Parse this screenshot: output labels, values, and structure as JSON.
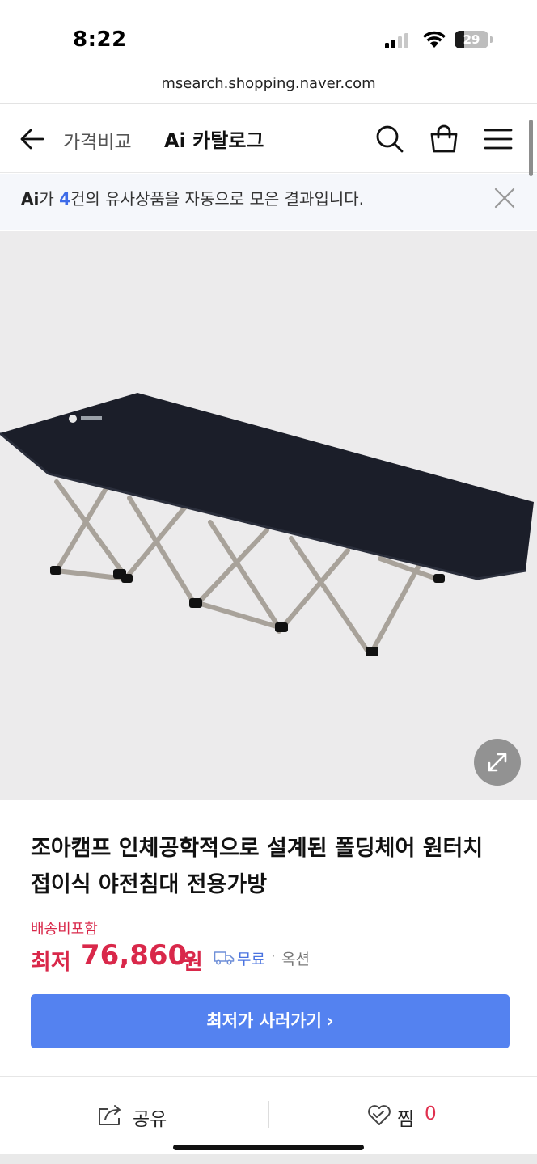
{
  "status_bar": {
    "time": "8:22",
    "battery_level": "29"
  },
  "browser": {
    "url": "msearch.shopping.naver.com"
  },
  "header": {
    "crumb_primary": "가격비교",
    "crumb_secondary": "Ai 카탈로그",
    "icons": [
      "back-arrow-icon",
      "search-icon",
      "shopping-bag-icon",
      "menu-icon"
    ]
  },
  "ai_notice": {
    "badge": "Ai",
    "prefix": "가 ",
    "count": "4",
    "suffix": "건의 유사상품을 자동으로 모은 결과입니다."
  },
  "product": {
    "title": "조아캠프 인체공학적으로 설계된 폴딩체어 원터치 접이식 야전침대 전용가방",
    "shipping_note": "배송비포함",
    "price_label": "최저",
    "price": "76,860",
    "price_unit": "원",
    "free_shipping": "무료",
    "separator": "·",
    "seller": "옥션"
  },
  "actions": {
    "buy_label": "최저가 사러가기",
    "buy_chevron": "›",
    "share_label": "공유",
    "wish_label": "찜",
    "wish_count": "0"
  },
  "colors": {
    "accent_blue": "#5482f0",
    "price_red": "#d9284a",
    "ai_count_blue": "#3d6be8"
  }
}
